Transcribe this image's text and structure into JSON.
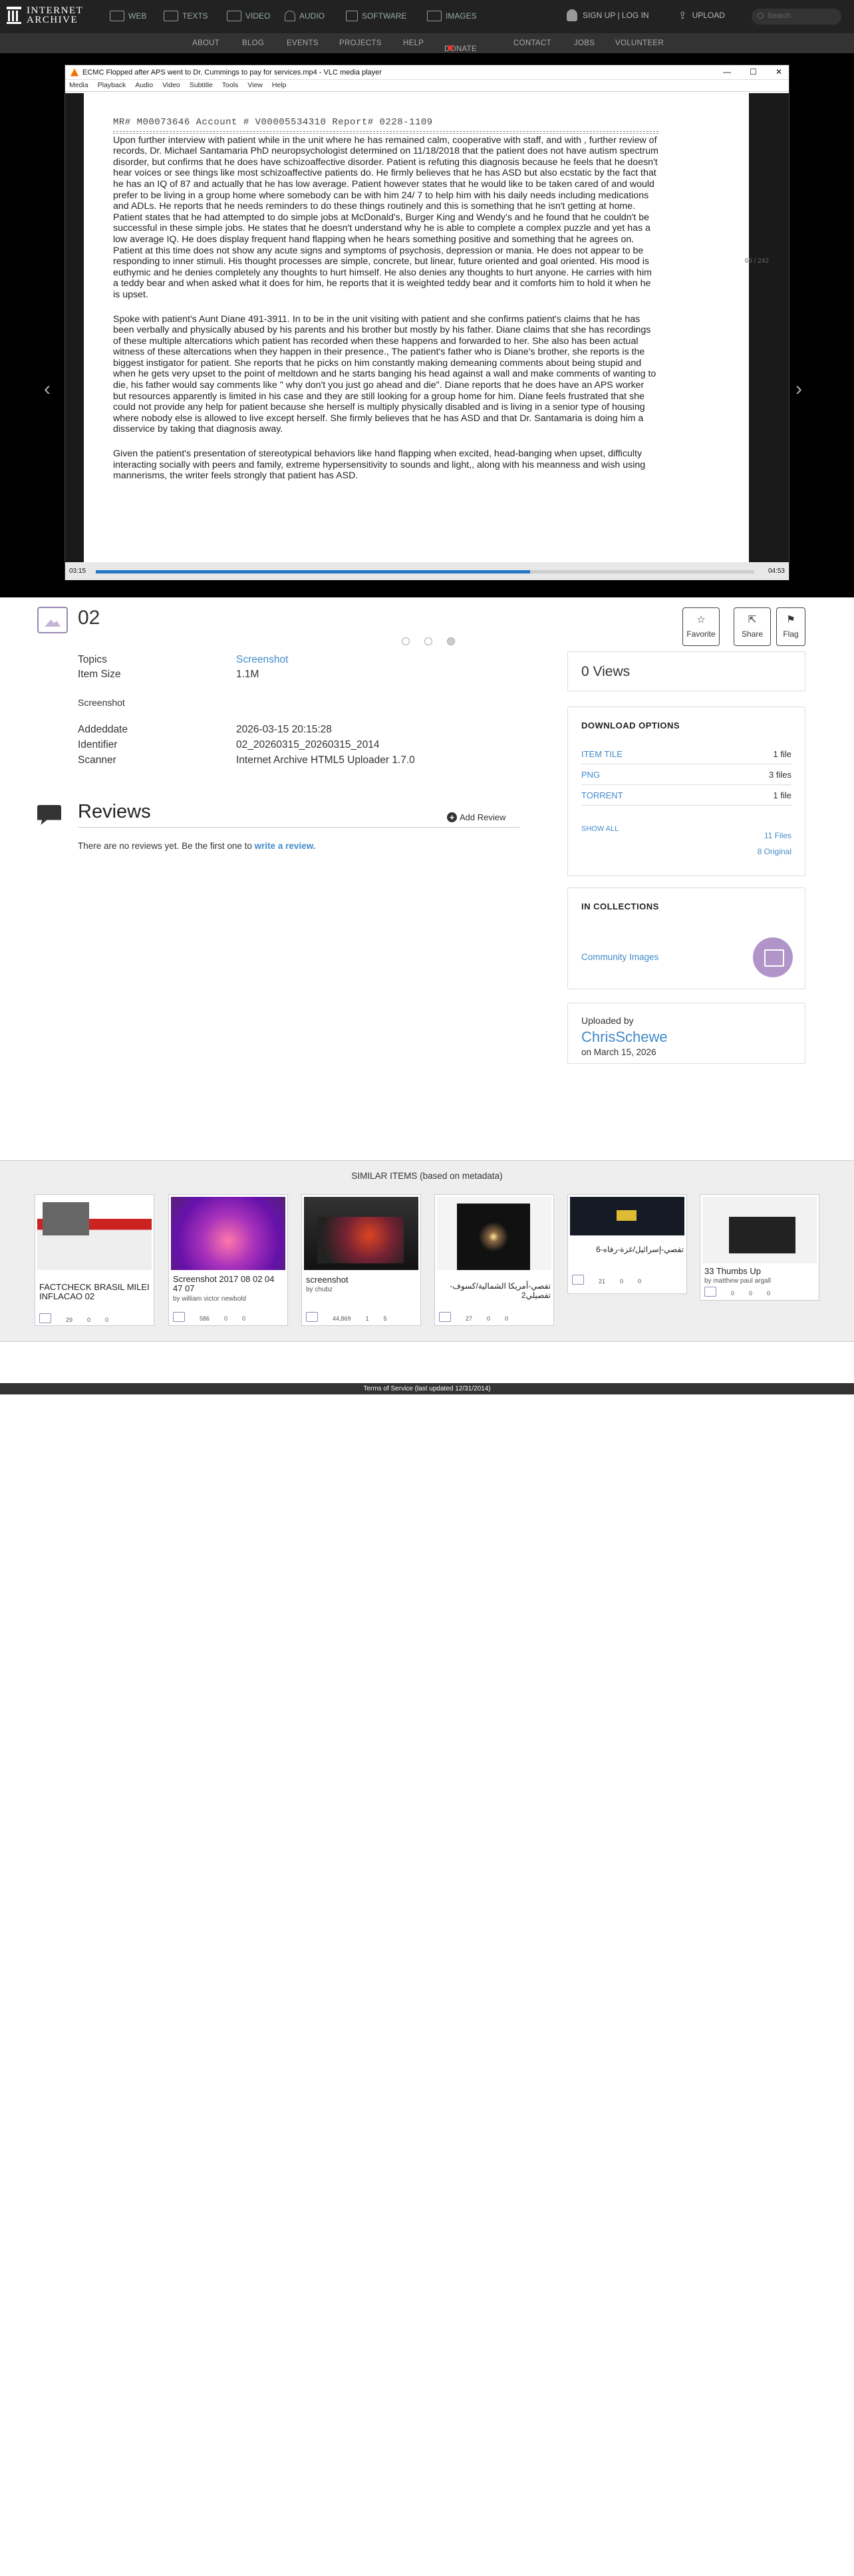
{
  "nav": {
    "logo_line1": "INTERNET",
    "logo_line2": "ARCHIVE",
    "items": [
      "WEB",
      "TEXTS",
      "VIDEO",
      "AUDIO",
      "SOFTWARE",
      "IMAGES"
    ],
    "signup": "SIGN UP | LOG IN",
    "upload": "UPLOAD",
    "search_placeholder": "Search"
  },
  "subnav": [
    "ABOUT",
    "BLOG",
    "EVENTS",
    "PROJECTS",
    "HELP",
    "DONATE",
    "CONTACT",
    "JOBS",
    "VOLUNTEER"
  ],
  "player": {
    "window_title": "ECMC Flopped after APS went to Dr. Cummings to pay for services.mp4 - VLC media player",
    "menus": [
      "Media",
      "Playback",
      "Audio",
      "Video",
      "Subtitle",
      "Tools",
      "View",
      "Help"
    ],
    "doc_header": "MR# M00073646      Account # V00005534310      Report# 0228-1109",
    "para1": "Upon further interview with patient while in the unit where he has remained calm, cooperative with staff,  and with , further review of records,  Dr. Michael Santamaria PhD neuropsychologist determined on 11/18/2018  that the patient does not have autism spectrum disorder, but confirms that he does have schizoaffective disorder.  Patient is refuting this diagnosis because he feels that he doesn't hear voices or see things like most schizoaffective patients do.  He firmly believes that he has ASD but also ecstatic by the fact that he has an IQ of 87 and actually that he has low average.  Patient however states that he would like to be taken  cared of and would prefer to be living in a group home where somebody can be with him 24/  7 to help him with his daily needs including medications and ADLs.  He reports that he needs reminders to do these things routinely and this is something that he isn't getting at home.  Patient states that he had attempted to  do simple jobs at McDonald's, Burger King and Wendy's and he found that he couldn't be successful in these simple jobs.  He states that he doesn't understand why he is able to complete a complex puzzle and yet has a low average IQ.  He does display frequent hand flapping when he hears something positive and something that he agrees on.  Patient at this time does not show any acute signs and symptoms of psychosis, depression or mania.  He does not appear to be responding to inner stimuli.  His thought processes are simple, concrete, but linear, future oriented and goal oriented.  His mood is euthymic and he denies completely any thoughts to hurt himself.  He also denies any thoughts to hurt anyone.  He carries with him a teddy bear and when asked what it does for him, he reports that it is weighted  teddy bear and it comforts him to hold  it when he is upset.",
    "para2": "Spoke with patient's Aunt Diane  491-3911.  In to be in the unit visiting with patient and she confirms patient's claims that he has been verbally and physically abused by his parents and his brother but mostly by his father.  Diane claims that she has recordings of these  multiple altercations which patient has recorded when these happens and forwarded to her.  She also has been actual witness of these altercations when they happen in their presence.,  The patient's father who is Diane's brother, she reports is the biggest instigator for patient.  She reports that he picks on him constantly making demeaning comments about being stupid and when he gets very upset to the point of meltdown and he starts banging his head against a wall and make comments of wanting to die, his father would say comments like \" why don't you just go ahead and die\".  Diane reports that he does have an APS worker but resources apparently is limited in his case and they are still looking for a group home for him.  Diane feels frustrated that she could not provide any help for patient because she herself is multiply physically disabled and is living in a senior type of housing where nobody else is allowed to live except herself.  She firmly believes that he has ASD and that Dr. Santamaria is doing him a disservice by taking that diagnosis away.",
    "para3": "Given the patient's presentation of stereotypical behaviors like hand flapping  when excited, head-banging when upset, difficulty interacting socially with peers and family, extreme hypersensitivity to sounds and light,, along with his meanness and wish using mannerisms, the writer feels strongly that patient has ASD.",
    "page_counter": "69 / 242",
    "time_elapsed": "03:15",
    "time_total": "04:53",
    "progress": 0.66
  },
  "item": {
    "title": "02",
    "actions": [
      "Favorite",
      "Share",
      "Flag"
    ],
    "topics_label": "Topics",
    "topics_value": "Screenshot",
    "size_label": "Item Size",
    "size_value": "1.1M",
    "description": "Screenshot",
    "added_label": "Addeddate",
    "added_value": "2026-03-15 20:15:28",
    "identifier_label": "Identifier",
    "identifier_value": "02_20260315_20260315_2014",
    "scanner_label": "Scanner",
    "scanner_value": "Internet Archive HTML5 Uploader 1.7.0"
  },
  "reviews": {
    "title": "Reviews",
    "add": "Add Review",
    "empty_text": "There are no reviews yet. Be the first one to ",
    "empty_link": "write a review."
  },
  "sidebar": {
    "views": "0 Views",
    "download_title": "DOWNLOAD OPTIONS",
    "downloads": [
      {
        "label": "ITEM TILE",
        "count": "1 file"
      },
      {
        "label": "PNG",
        "count": "3 files"
      },
      {
        "label": "TORRENT",
        "count": "1 file"
      }
    ],
    "show_all": "SHOW ALL",
    "files_count": "11 Files",
    "original_count": "8 Original",
    "collections_title": "IN COLLECTIONS",
    "collection": "Community Images",
    "uploaded_by_label": "Uploaded by",
    "uploader": "ChrisSchewe",
    "upload_date": "on March 15, 2026"
  },
  "similar": {
    "title": "SIMILAR ITEMS (based on metadata)",
    "items": [
      {
        "title": "FACTCHECK BRASIL MILEI INFLACAO 02",
        "by": "",
        "views": "29",
        "favs": "0",
        "reviews": "0"
      },
      {
        "title": "Screenshot 2017 08 02 04 47 07",
        "by": "by william victor newbold",
        "views": "586",
        "favs": "0",
        "reviews": "0"
      },
      {
        "title": "screenshot",
        "by": "by chubz",
        "views": "44,869",
        "favs": "1",
        "reviews": "5"
      },
      {
        "title": "تفصي-أمريكا الشمالية/كسوف-تفصيلي2",
        "by": "",
        "views": "27",
        "favs": "0",
        "reviews": "0"
      },
      {
        "title": "تفصي-إسرائيل/غزة-رفاه-6",
        "by": "",
        "views": "21",
        "favs": "0",
        "reviews": "0"
      },
      {
        "title": "33 Thumbs Up",
        "by": "by matthew paul argall",
        "views": "0",
        "favs": "0",
        "reviews": "0"
      }
    ]
  },
  "footer": "Terms of Service (last updated 12/31/2014)"
}
